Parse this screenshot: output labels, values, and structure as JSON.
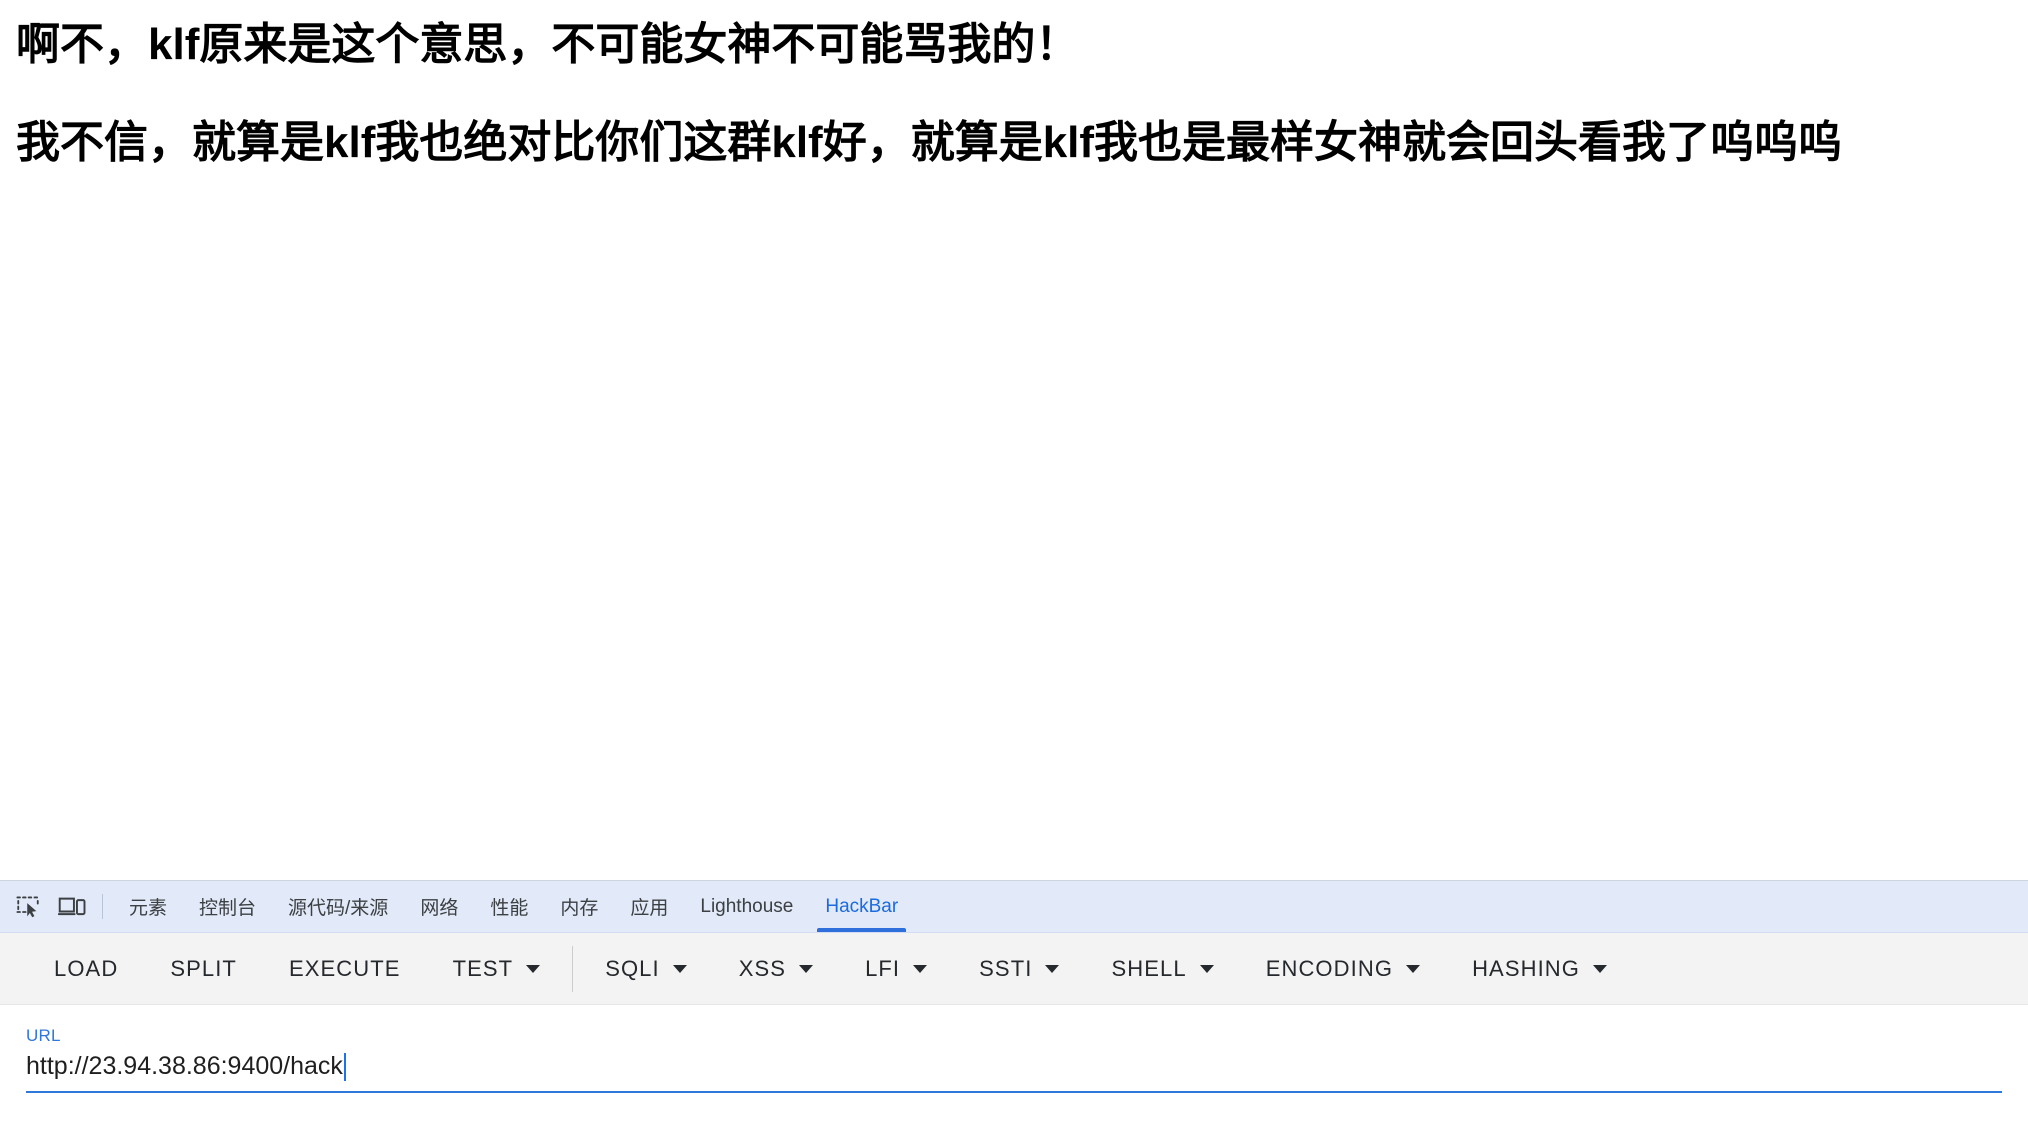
{
  "page": {
    "paragraphs": [
      "啊不，klf原来是这个意思，不可能女神不可能骂我的！",
      "我不信，就算是klf我也绝对比你们这群klf好，就算是klf我也是最样女神就会回头看我了呜呜呜"
    ]
  },
  "devtools": {
    "icons": {
      "inspect": "inspect-element-icon",
      "device": "device-toolbar-icon"
    },
    "tabs": [
      {
        "label": "元素",
        "active": false
      },
      {
        "label": "控制台",
        "active": false
      },
      {
        "label": "源代码/来源",
        "active": false
      },
      {
        "label": "网络",
        "active": false
      },
      {
        "label": "性能",
        "active": false
      },
      {
        "label": "内存",
        "active": false
      },
      {
        "label": "应用",
        "active": false
      },
      {
        "label": "Lighthouse",
        "active": false
      },
      {
        "label": "HackBar",
        "active": true
      }
    ],
    "active_tab": "HackBar",
    "accent_color": "#2f6fdc",
    "tabbar_background": "#e2e9f8"
  },
  "hackbar": {
    "actions": [
      {
        "label": "LOAD",
        "dropdown": false
      },
      {
        "label": "SPLIT",
        "dropdown": false
      },
      {
        "label": "EXECUTE",
        "dropdown": false
      },
      {
        "label": "TEST",
        "dropdown": true
      }
    ],
    "payloads": [
      {
        "label": "SQLI",
        "dropdown": true
      },
      {
        "label": "XSS",
        "dropdown": true
      },
      {
        "label": "LFI",
        "dropdown": true
      },
      {
        "label": "SSTI",
        "dropdown": true
      },
      {
        "label": "SHELL",
        "dropdown": true
      },
      {
        "label": "ENCODING",
        "dropdown": true
      },
      {
        "label": "HASHING",
        "dropdown": true
      }
    ],
    "url_field": {
      "label": "URL",
      "value": "http://23.94.38.86:9400/hack",
      "placeholder": "URL",
      "focused": true
    }
  }
}
